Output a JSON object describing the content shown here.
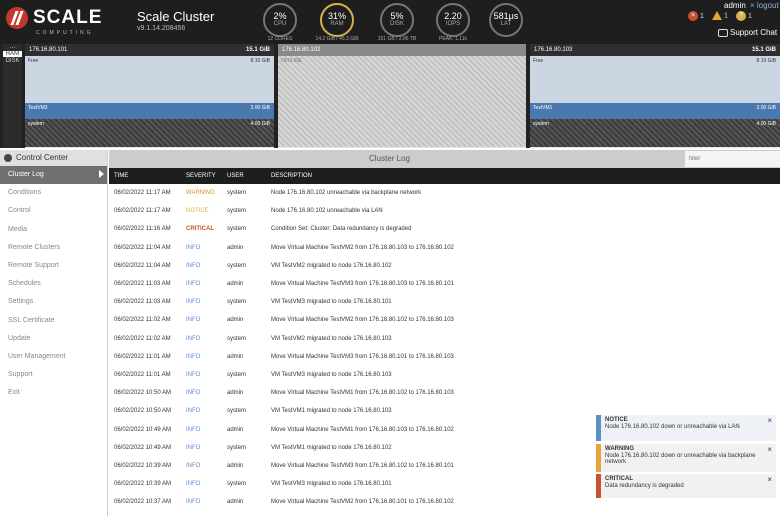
{
  "header": {
    "logo_word": "SCALE",
    "logo_sub": "COMPUTING",
    "cluster_name": "Scale Cluster",
    "version": "v9.1.14.208456",
    "gauges": [
      {
        "value": "2%",
        "label": "CPU",
        "sub": "12 CORES",
        "accent": false
      },
      {
        "value": "31%",
        "label": "RAM",
        "sub": "14.2 GiB / 45.3 GiB",
        "accent": true
      },
      {
        "value": "5%",
        "label": "DISK",
        "sub": "151 GB / 2.86 TB",
        "accent": false
      },
      {
        "value": "2.20",
        "label": "IOPS",
        "sub": "PEAK: 1.11k",
        "accent": false
      },
      {
        "value": "581μs",
        "label": "LAT",
        "sub": "",
        "accent": false
      }
    ],
    "user": "admin",
    "logout": "× logout",
    "alerts": {
      "critical": "1",
      "warning": "1",
      "notice": "1"
    },
    "critical_glyph": "×",
    "notice_glyph": "?",
    "support_chat": "Support Chat"
  },
  "node_toggle": {
    "options": [
      "RAM",
      "DISK"
    ],
    "selected": "RAM"
  },
  "nodes": [
    {
      "ip": "176.16.80.101",
      "capacity": "15.1 GiB",
      "offline": false,
      "free_label": "Free",
      "free": "8.10 GiB",
      "vm_label": "TestVM3",
      "vm": "3.00 GiB",
      "sys_label": "system",
      "sys": "4.00 GiB"
    },
    {
      "ip": "176.16.80.102",
      "capacity": "",
      "offline": true,
      "offline_label": "OFFLINE"
    },
    {
      "ip": "176.16.80.103",
      "capacity": "15.1 GiB",
      "offline": false,
      "free_label": "Free",
      "free": "8.10 GiB",
      "vm_label": "TestVM1",
      "vm": "3.00 GiB",
      "sys_label": "system",
      "sys": "4.00 GiB"
    }
  ],
  "sidebar": {
    "title": "Control Center",
    "items": [
      "Cluster Log",
      "Conditions",
      "Control",
      "Media",
      "Remote Clusters",
      "Remote Support",
      "Schedules",
      "Settings",
      "SSL Certificate",
      "Update",
      "User Management",
      "Support",
      "Exit"
    ],
    "active": "Cluster Log"
  },
  "log": {
    "title": "Cluster Log",
    "filter_placeholder": "filter",
    "columns": [
      "TIME",
      "SEVERITY",
      "USER",
      "DESCRIPTION"
    ],
    "rows": [
      [
        "06/02/2022 11:17 AM",
        "WARNING",
        "system",
        "Node 176.16.80.102 unreachable via backplane network"
      ],
      [
        "06/02/2022 11:17 AM",
        "NOTICE",
        "system",
        "Node 176.16.80.102 unreachable via LAN"
      ],
      [
        "06/02/2022 11:16 AM",
        "CRITICAL",
        "system",
        "Condition Set: Cluster: Data redundancy is degraded"
      ],
      [
        "06/02/2022 11:04 AM",
        "INFO",
        "admin",
        "Move Virtual Machine TestVM2 from 176.16.80.103 to 176.16.80.102"
      ],
      [
        "06/02/2022 11:04 AM",
        "INFO",
        "system",
        "VM TestVM2 migrated to node 176.16.80.102"
      ],
      [
        "06/02/2022 11:03 AM",
        "INFO",
        "admin",
        "Move Virtual Machine TestVM3 from 176.16.80.103 to 176.16.80.101"
      ],
      [
        "06/02/2022 11:03 AM",
        "INFO",
        "system",
        "VM TestVM3 migrated to node 176.16.80.101"
      ],
      [
        "06/02/2022 11:02 AM",
        "INFO",
        "admin",
        "Move Virtual Machine TestVM2 from 176.16.80.102 to 176.16.80.103"
      ],
      [
        "06/02/2022 11:02 AM",
        "INFO",
        "system",
        "VM TestVM2 migrated to node 176.16.80.103"
      ],
      [
        "06/02/2022 11:01 AM",
        "INFO",
        "admin",
        "Move Virtual Machine TestVM3 from 176.16.80.101 to 176.16.80.103"
      ],
      [
        "06/02/2022 11:01 AM",
        "INFO",
        "system",
        "VM TestVM3 migrated to node 176.16.80.103"
      ],
      [
        "06/02/2022 10:50 AM",
        "INFO",
        "admin",
        "Move Virtual Machine TestVM1 from 176.16.80.102 to 176.16.80.103"
      ],
      [
        "06/02/2022 10:50 AM",
        "INFO",
        "system",
        "VM TestVM1 migrated to node 176.16.80.103"
      ],
      [
        "06/02/2022 10:49 AM",
        "INFO",
        "admin",
        "Move Virtual Machine TestVM1 from 176.16.80.103 to 176.16.80.102"
      ],
      [
        "06/02/2022 10:49 AM",
        "INFO",
        "system",
        "VM TestVM1 migrated to node 176.16.80.102"
      ],
      [
        "06/02/2022 10:39 AM",
        "INFO",
        "admin",
        "Move Virtual Machine TestVM3 from 176.16.80.102 to 176.16.80.101"
      ],
      [
        "06/02/2022 10:39 AM",
        "INFO",
        "system",
        "VM TestVM3 migrated to node 176.16.80.101"
      ],
      [
        "06/02/2022 10:37 AM",
        "INFO",
        "admin",
        "Move Virtual Machine TestVM2 from 176.16.80.101 to 176.16.80.102"
      ]
    ]
  },
  "toasts": [
    {
      "type": "notice",
      "title": "NOTICE",
      "message": "Node 176.16.80.102 down or unreachable via LAN"
    },
    {
      "type": "warning",
      "title": "WARNING",
      "message": "Node 176.16.80.102 down or unreachable via backplane network"
    },
    {
      "type": "critical",
      "title": "CRITICAL",
      "message": "Data redundancy is degraded"
    }
  ],
  "toast_close": "×",
  "colors": {
    "notice": "#5b8fc9",
    "warning": "#e8a23a",
    "critical": "#c8522f",
    "accent": "#d4b34a"
  }
}
